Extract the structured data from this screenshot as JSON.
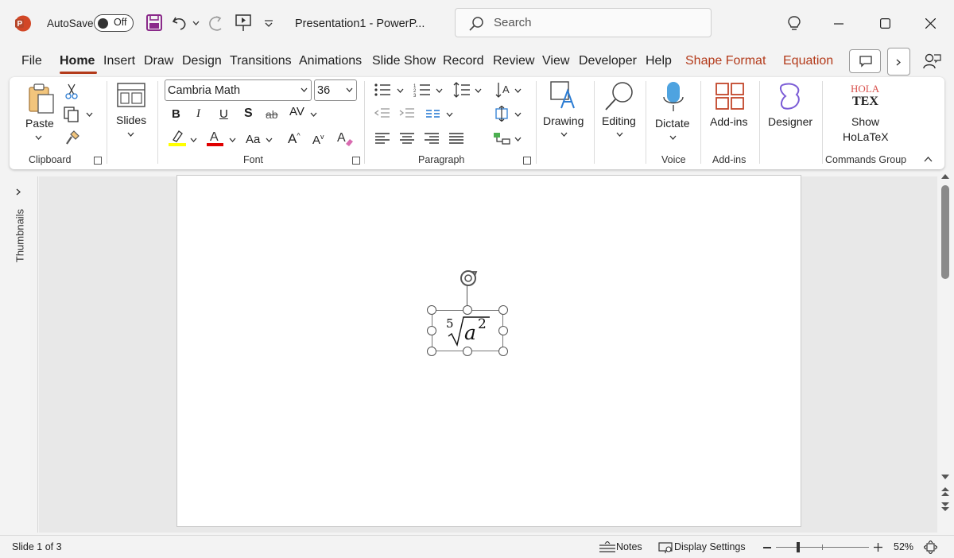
{
  "titlebar": {
    "autosave_label": "AutoSave",
    "autosave_state": "Off",
    "doc_title": "Presentation1  -  PowerP...",
    "search_placeholder": "Search"
  },
  "tabs": [
    {
      "label": "File"
    },
    {
      "label": "Home"
    },
    {
      "label": "Insert"
    },
    {
      "label": "Draw"
    },
    {
      "label": "Design"
    },
    {
      "label": "Transitions"
    },
    {
      "label": "Animations"
    },
    {
      "label": "Slide Show"
    },
    {
      "label": "Record"
    },
    {
      "label": "Review"
    },
    {
      "label": "View"
    },
    {
      "label": "Developer"
    },
    {
      "label": "Help"
    },
    {
      "label": "Shape Format"
    },
    {
      "label": "Equation"
    }
  ],
  "ribbon": {
    "clipboard": {
      "paste": "Paste",
      "group": "Clipboard"
    },
    "slides": {
      "label": "Slides"
    },
    "font": {
      "name": "Cambria Math",
      "size": "36",
      "group": "Font",
      "case": "Aa"
    },
    "paragraph": {
      "group": "Paragraph"
    },
    "drawing": {
      "label": "Drawing"
    },
    "editing": {
      "label": "Editing"
    },
    "voice": {
      "dictate": "Dictate",
      "group": "Voice"
    },
    "addins": {
      "label": "Add-ins",
      "group": "Add-ins"
    },
    "designer": {
      "label": "Designer"
    },
    "holatex": {
      "line1": "Show",
      "line2": "HoLaTeX",
      "group": "Commands Group",
      "logo_top": "HOLA",
      "logo_bottom": "TEX"
    }
  },
  "sidepane": {
    "label": "Thumbnails"
  },
  "equation": {
    "index": "5",
    "base": "a",
    "exponent": "2"
  },
  "statusbar": {
    "slide_info": "Slide 1 of 3",
    "notes": "Notes",
    "display": "Display Settings",
    "zoom": "52%"
  },
  "colors": {
    "accent": "#b33a1a",
    "highlight": "#ffff00",
    "font_color": "#e00000"
  }
}
